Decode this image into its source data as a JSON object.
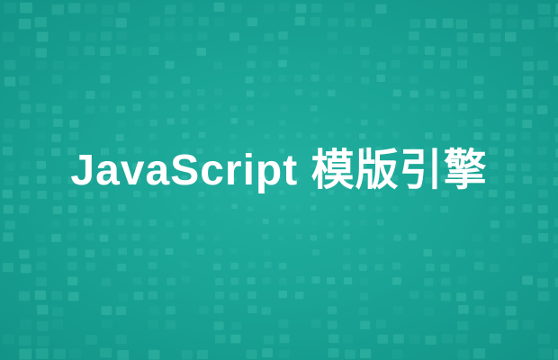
{
  "banner": {
    "title": "JavaScript 模版引擎",
    "colors": {
      "background": "#1aa596",
      "background_edge": "#129487",
      "tile": "#5fd6c4",
      "text": "#ffffff"
    }
  }
}
